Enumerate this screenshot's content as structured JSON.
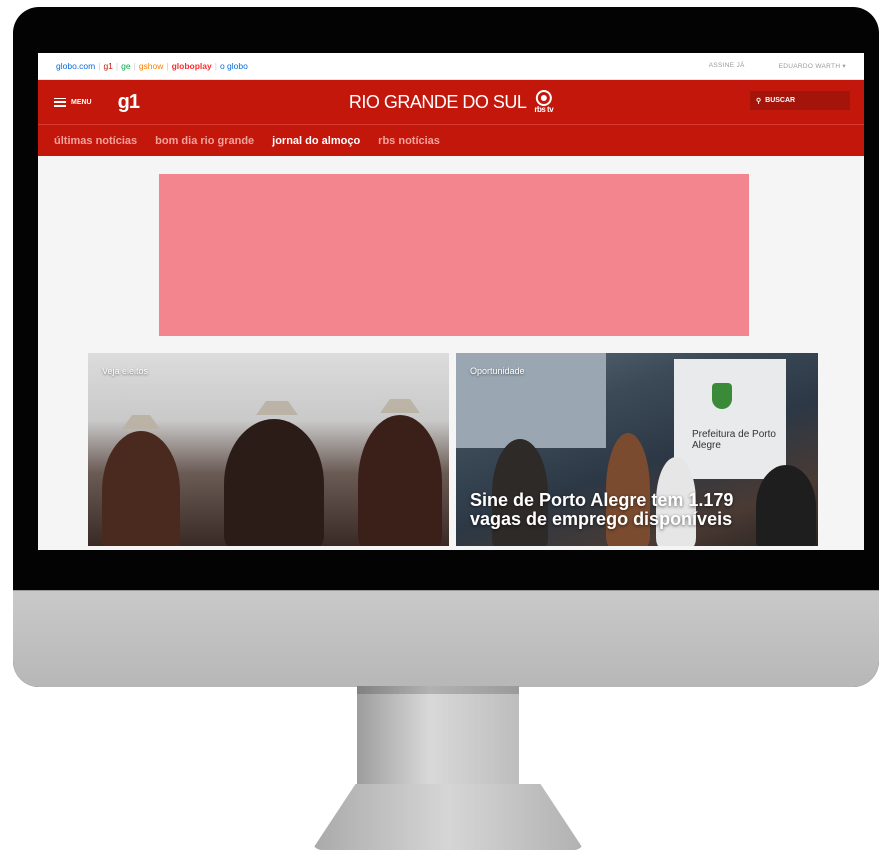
{
  "globo_bar": {
    "links": [
      {
        "label": "globo.com",
        "color": "#0669de"
      },
      {
        "label": "g1",
        "color": "#c4170c"
      },
      {
        "label": "ge",
        "color": "#06aa48"
      },
      {
        "label": "gshow",
        "color": "#ff7f00"
      },
      {
        "label": "globoplay",
        "color": "#ff2c2c"
      },
      {
        "label": "o globo",
        "color": "#0669de"
      }
    ],
    "subscribe_label": "ASSINE JÁ",
    "user_label": "EDUARDO WARTH ▾"
  },
  "header": {
    "menu_label": "MENU",
    "logo": "g1",
    "region_title": "RIO GRANDE DO SUL",
    "broadcaster": "rbs tv",
    "search_label": "BUSCAR",
    "brand_color": "#c4170c"
  },
  "subnav": {
    "items": [
      {
        "label": "últimas notícias"
      },
      {
        "label": "bom dia rio grande"
      },
      {
        "label": "jornal do almoço"
      },
      {
        "label": "rbs notícias"
      }
    ]
  },
  "ad": {
    "color": "#f2858e"
  },
  "cards": [
    {
      "tag": "Veja eleitos",
      "headline": ""
    },
    {
      "tag": "Oportunidade",
      "headline": "Sine de Porto Alegre tem 1.179 vagas de emprego disponíveis",
      "sign": "Prefeitura de Porto Alegre"
    }
  ]
}
